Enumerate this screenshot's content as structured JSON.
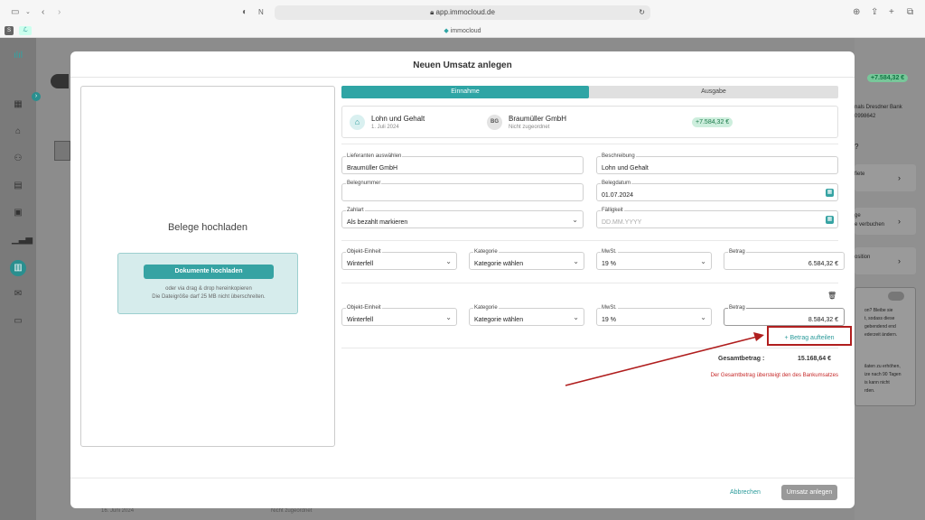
{
  "browser": {
    "url": "app.immocloud.de",
    "tab_title": "immocloud"
  },
  "modal": {
    "title": "Neuen Umsatz anlegen",
    "upload_title": "Belege hochladen",
    "upload_button": "Dokumente hochladen",
    "upload_hint_1": "oder via drag & drop hereinkopieren",
    "upload_hint_2": "Die Dateigröße darf 25 MB nicht überschreiten.",
    "tabs": {
      "income": "Einnahme",
      "expense": "Ausgabe"
    },
    "transaction": {
      "title": "Lohn und Gehalt",
      "date": "1. Juli 2024",
      "initials": "BG",
      "counterparty": "Braumüller GmbH",
      "status": "Nicht zugeordnet",
      "amount": "+7.584,32 €"
    },
    "fields": {
      "supplier_label": "Lieferanten auswählen",
      "supplier_value": "Braumüller GmbH",
      "description_label": "Beschreibung",
      "description_value": "Lohn und Gehalt",
      "receipt_number_label": "Belegnummer",
      "receipt_number_value": "",
      "receipt_date_label": "Belegdatum",
      "receipt_date_value": "01.07.2024",
      "payment_label": "Zahlart",
      "payment_value": "Als bezahlt markieren",
      "due_label": "Fälligkeit",
      "due_placeholder": "DD.MM.YYYY"
    },
    "splits": [
      {
        "unit_label": "Objekt-Einheit",
        "unit_value": "Winterfell",
        "category_label": "Kategorie",
        "category_value": "Kategorie wählen",
        "vat_label": "MwSt.",
        "vat_value": "19 %",
        "amount_label": "Betrag",
        "amount_value": "6.584,32 €"
      },
      {
        "unit_label": "Objekt-Einheit",
        "unit_value": "Winterfell",
        "category_label": "Kategorie",
        "category_value": "Kategorie wählen",
        "vat_label": "MwSt.",
        "vat_value": "19 %",
        "amount_label": "Betrag",
        "amount_value": "8.584,32 €"
      }
    ],
    "split_button": "+ Betrag aufteilen",
    "total_label": "Gesamtbetrag :",
    "total_value": "15.168,64 €",
    "error": "Der Gesamtbetrag übersteigt den des Bankumsatzes",
    "cancel": "Abbrechen",
    "save": "Umsatz anlegen"
  },
  "background": {
    "amount_badge": "+7.584,32 €",
    "bank": "nals Dresdner Bank",
    "account": "0998642",
    "qmark": "?",
    "card1": "fiete",
    "card2a": "ge",
    "card2b": "e verbuchen",
    "card3": "osition",
    "info": [
      "on? Bleibe sie",
      "t, sodass diese",
      "gebendend end",
      "ederzeit ändern."
    ],
    "info2": [
      "ilaten zu erhöhen,",
      "ize nach 90 Tagen",
      "is kann nicht",
      "rden."
    ],
    "row_date": "16. Juni 2024",
    "row_status": "Nicht zugeordnet"
  },
  "colors": {
    "accent": "#2fa5a5",
    "error": "#c62828",
    "highlight_box": "#b01e1e"
  }
}
